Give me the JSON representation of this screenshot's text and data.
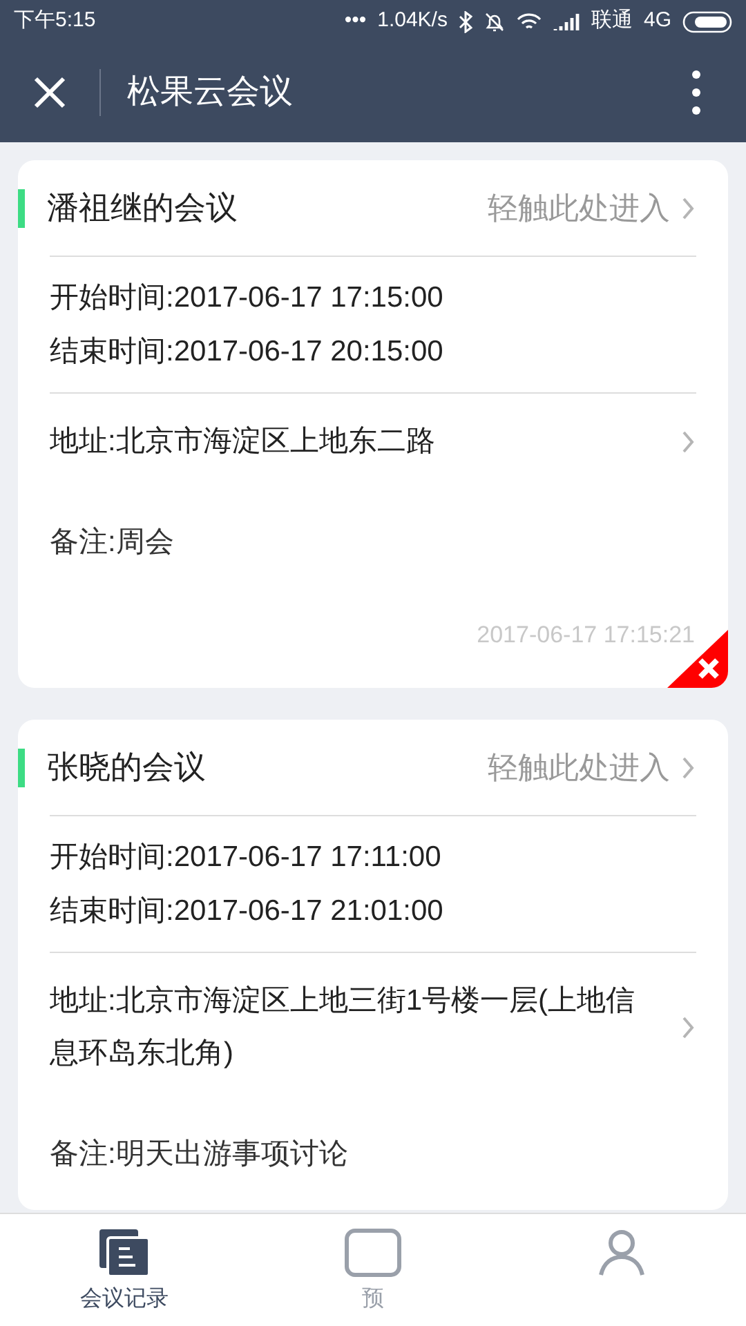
{
  "status_bar": {
    "time": "下午5:15",
    "dots": "•••",
    "speed": "1.04K/s",
    "carrier": "联通",
    "network": "4G"
  },
  "header": {
    "title": "松果云会议"
  },
  "meetings": [
    {
      "title": "潘祖继的会议",
      "enter": "轻触此处进入",
      "start": "开始时间:2017-06-17 17:15:00",
      "end": "结束时间:2017-06-17 20:15:00",
      "address": "地址:北京市海淀区上地东二路",
      "note": "备注:周会",
      "created": "2017-06-17 17:15:21",
      "deletable": true
    },
    {
      "title": "张晓的会议",
      "enter": "轻触此处进入",
      "start": "开始时间:2017-06-17 17:11:00",
      "end": "结束时间:2017-06-17 21:01:00",
      "address": "地址:北京市海淀区上地三街1号楼一层(上地信息环岛东北角)",
      "note": "备注:明天出游事项讨论",
      "deletable": false
    }
  ],
  "tabs": [
    {
      "label": "会议记录",
      "selected": true,
      "kind": "records"
    },
    {
      "label": "预",
      "selected": false,
      "kind": "book"
    },
    {
      "kind": "profile",
      "selected": false
    }
  ]
}
